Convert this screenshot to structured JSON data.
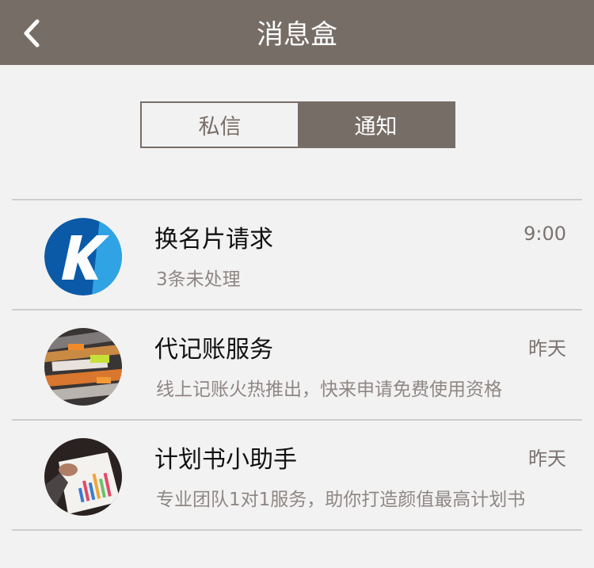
{
  "header": {
    "title": "消息盒",
    "back_icon": "chevron-left-icon",
    "background_color": "#776d67"
  },
  "tabs": [
    {
      "label": "私信",
      "active": false
    },
    {
      "label": "通知",
      "active": true
    }
  ],
  "messages": [
    {
      "title": "换名片请求",
      "time": "9:00",
      "subtitle": "3条未处理",
      "avatar_icon": "k-logo-icon"
    },
    {
      "title": "代记账服务",
      "time": "昨天",
      "subtitle": "线上记账火热推出，快来申请免费使用资格",
      "avatar_icon": "documents-photo-icon"
    },
    {
      "title": "计划书小助手",
      "time": "昨天",
      "subtitle": "专业团队1对1服务，助你打造颜值最高计划书",
      "avatar_icon": "chart-photo-icon"
    }
  ],
  "colors": {
    "accent": "#776d67",
    "background": "#f3f2f2",
    "divider": "#cfcdcc"
  }
}
